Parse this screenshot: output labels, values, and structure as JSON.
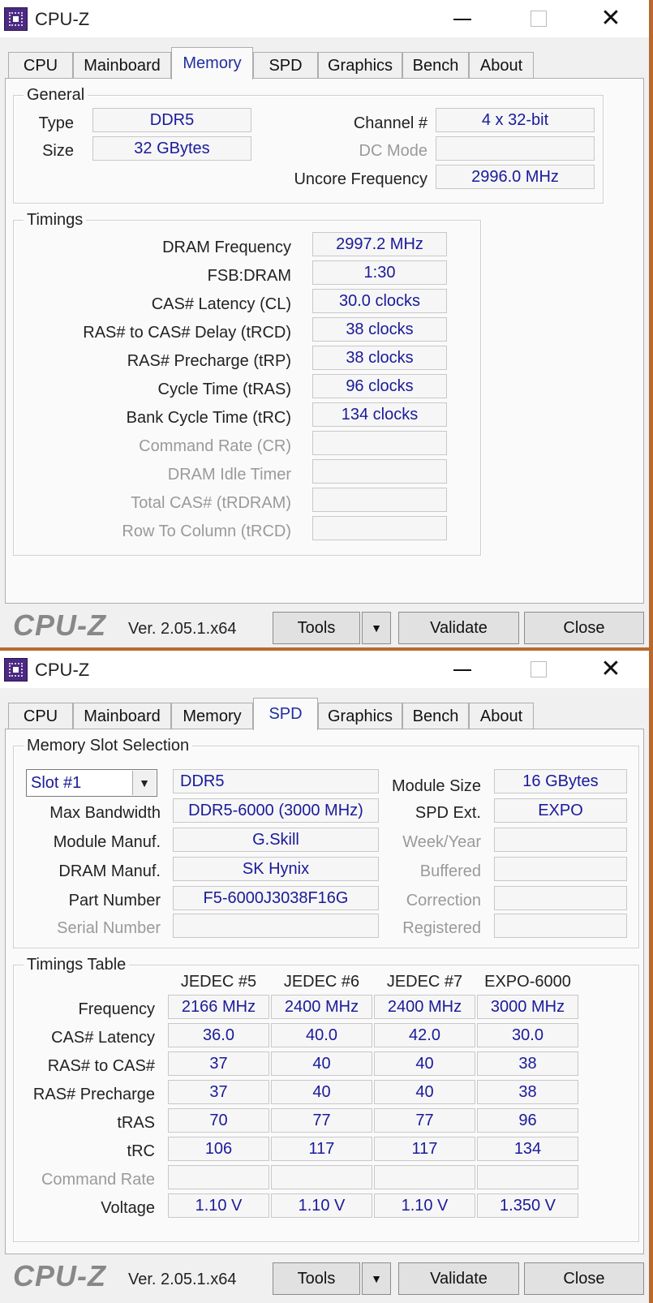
{
  "app": {
    "title": "CPU-Z",
    "logo": "CPU-Z",
    "version": "Ver. 2.05.1.x64",
    "tools": "Tools",
    "validate": "Validate",
    "close": "Close",
    "dropdown_glyph": "▼",
    "min_glyph": "",
    "max_glyph": "",
    "close_glyph": "✕"
  },
  "tabs": [
    "CPU",
    "Mainboard",
    "Memory",
    "SPD",
    "Graphics",
    "Bench",
    "About"
  ],
  "memory": {
    "general": {
      "legend": "General",
      "type_label": "Type",
      "type_value": "DDR5",
      "size_label": "Size",
      "size_value": "32 GBytes",
      "channel_label": "Channel #",
      "channel_value": "4 x 32-bit",
      "dcmode_label": "DC Mode",
      "dcmode_value": "",
      "uncore_label": "Uncore Frequency",
      "uncore_value": "2996.0 MHz"
    },
    "timings": {
      "legend": "Timings",
      "rows": [
        {
          "label": "DRAM Frequency",
          "value": "2997.2 MHz"
        },
        {
          "label": "FSB:DRAM",
          "value": "1:30"
        },
        {
          "label": "CAS# Latency (CL)",
          "value": "30.0 clocks"
        },
        {
          "label": "RAS# to CAS# Delay (tRCD)",
          "value": "38 clocks"
        },
        {
          "label": "RAS# Precharge (tRP)",
          "value": "38 clocks"
        },
        {
          "label": "Cycle Time (tRAS)",
          "value": "96 clocks"
        },
        {
          "label": "Bank Cycle Time (tRC)",
          "value": "134 clocks"
        },
        {
          "label": "Command Rate (CR)",
          "value": ""
        },
        {
          "label": "DRAM Idle Timer",
          "value": ""
        },
        {
          "label": "Total CAS# (tRDRAM)",
          "value": ""
        },
        {
          "label": "Row To Column (tRCD)",
          "value": ""
        }
      ]
    }
  },
  "spd": {
    "slot": {
      "legend": "Memory Slot Selection",
      "selected": "Slot #1",
      "type_value": "DDR5",
      "module_size_label": "Module Size",
      "module_size_value": "16 GBytes",
      "max_bw_label": "Max Bandwidth",
      "max_bw_value": "DDR5-6000 (3000 MHz)",
      "spd_ext_label": "SPD Ext.",
      "spd_ext_value": "EXPO",
      "module_manuf_label": "Module Manuf.",
      "module_manuf_value": "G.Skill",
      "week_year_label": "Week/Year",
      "week_year_value": "",
      "dram_manuf_label": "DRAM Manuf.",
      "dram_manuf_value": "SK Hynix",
      "buffered_label": "Buffered",
      "buffered_value": "",
      "part_label": "Part Number",
      "part_value": "F5-6000J3038F16G",
      "correction_label": "Correction",
      "correction_value": "",
      "serial_label": "Serial Number",
      "serial_value": "",
      "registered_label": "Registered",
      "registered_value": ""
    },
    "table": {
      "legend": "Timings Table",
      "columns": [
        "JEDEC #5",
        "JEDEC #6",
        "JEDEC #7",
        "EXPO-6000"
      ],
      "rows": [
        {
          "label": "Frequency",
          "values": [
            "2166 MHz",
            "2400 MHz",
            "2400 MHz",
            "3000 MHz"
          ]
        },
        {
          "label": "CAS# Latency",
          "values": [
            "36.0",
            "40.0",
            "42.0",
            "30.0"
          ]
        },
        {
          "label": "RAS# to CAS#",
          "values": [
            "37",
            "40",
            "40",
            "38"
          ]
        },
        {
          "label": "RAS# Precharge",
          "values": [
            "37",
            "40",
            "40",
            "38"
          ]
        },
        {
          "label": "tRAS",
          "values": [
            "70",
            "77",
            "77",
            "96"
          ]
        },
        {
          "label": "tRC",
          "values": [
            "106",
            "117",
            "117",
            "134"
          ]
        },
        {
          "label": "Command Rate",
          "values": [
            "",
            "",
            "",
            ""
          ]
        },
        {
          "label": "Voltage",
          "values": [
            "1.10 V",
            "1.10 V",
            "1.10 V",
            "1.350 V"
          ]
        }
      ]
    }
  }
}
